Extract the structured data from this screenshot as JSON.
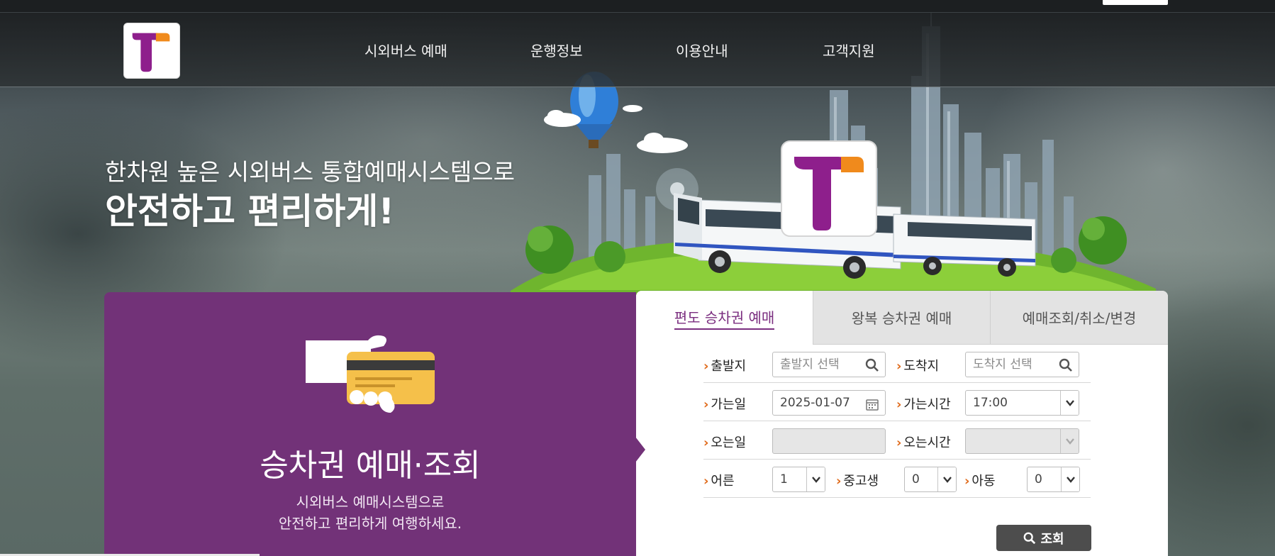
{
  "header": {
    "nav": [
      "시외버스 예매",
      "운행정보",
      "이용안내",
      "고객지원"
    ]
  },
  "hero": {
    "line1": "한차원 높은 시외버스 통합예매시스템으로",
    "line2": "안전하고 편리하게!"
  },
  "promo": {
    "title": "승차권 예매·조회",
    "sub1": "시외버스 예매시스템으로",
    "sub2": "안전하고 편리하게 여행하세요."
  },
  "tabs": [
    "편도 승차권 예매",
    "왕복 승차권 예매",
    "예매조회/취소/변경"
  ],
  "form": {
    "origin_label": "출발지",
    "origin_placeholder": "출발지 선택",
    "dest_label": "도착지",
    "dest_placeholder": "도착지 선택",
    "go_date_label": "가는일",
    "go_date_value": "2025-01-07",
    "go_time_label": "가는시간",
    "go_time_value": "17:00",
    "return_date_label": "오는일",
    "return_time_label": "오는시간",
    "adult_label": "어른",
    "adult_value": "1",
    "youth_label": "중고생",
    "youth_value": "0",
    "child_label": "아동",
    "child_value": "0",
    "search_label": "조회"
  },
  "colors": {
    "brand_purple": "#723278",
    "accent_orange": "#f08a1c",
    "button_gray": "#4d4d4d"
  }
}
